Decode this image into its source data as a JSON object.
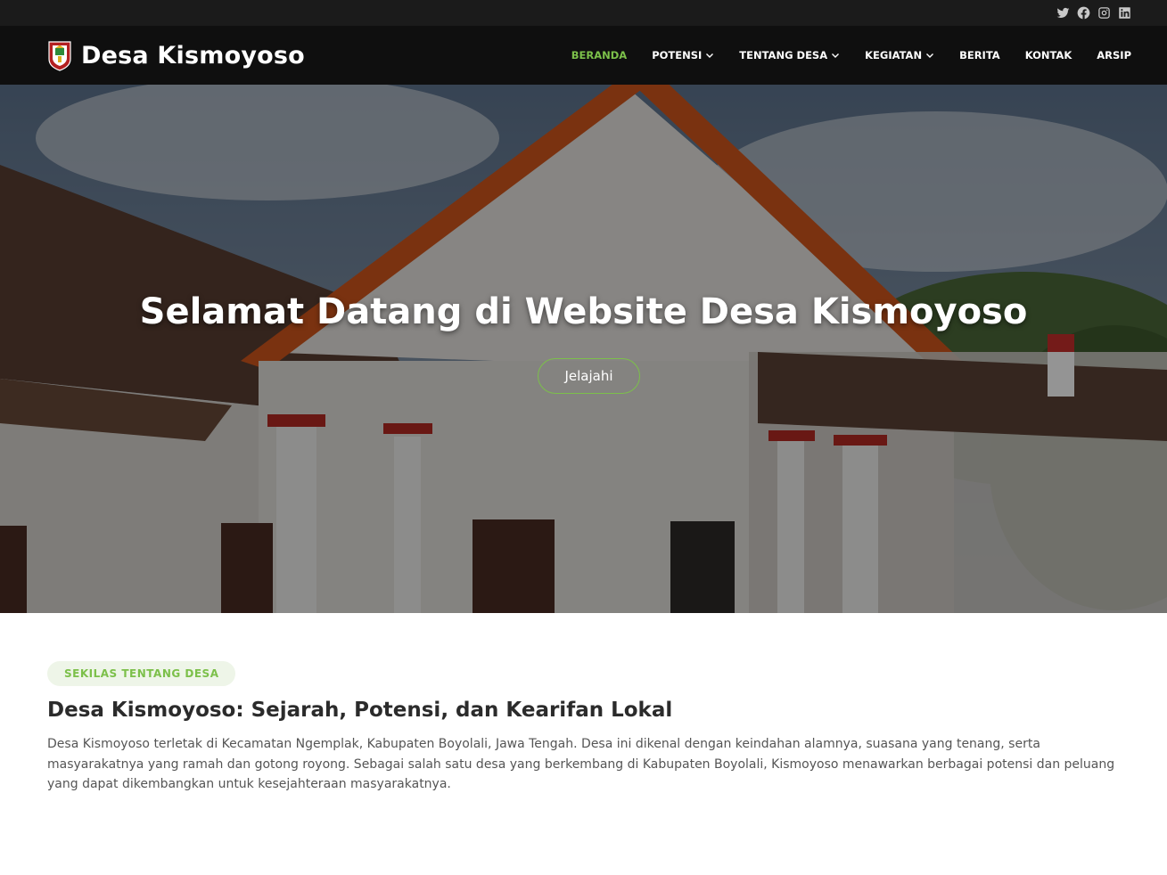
{
  "topbar": {
    "socials": [
      {
        "icon": "twitter-icon"
      },
      {
        "icon": "facebook-icon"
      },
      {
        "icon": "instagram-icon"
      },
      {
        "icon": "linkedin-icon"
      }
    ]
  },
  "header": {
    "brand_name": "Desa Kismoyoso",
    "logo_icon": "village-emblem-icon",
    "nav": {
      "beranda": "BERANDA",
      "potensi": "POTENSI",
      "tentang": "TENTANG DESA",
      "kegiatan": "KEGIATAN",
      "berita": "BERITA",
      "kontak": "KONTAK",
      "arsip": "ARSIP"
    }
  },
  "hero": {
    "title": "Selamat Datang di Website Desa Kismoyoso",
    "button_label": "Jelajahi"
  },
  "about": {
    "badge": "SEKILAS TENTANG DESA",
    "title": "Desa Kismoyoso: Sejarah, Potensi, dan Kearifan Lokal",
    "text": "Desa Kismoyoso terletak di Kecamatan Ngemplak, Kabupaten Boyolali, Jawa Tengah. Desa ini dikenal dengan keindahan alamnya, suasana yang tenang, serta masyarakatnya yang ramah dan gotong royong. Sebagai salah satu desa yang berkembang di Kabupaten Boyolali, Kismoyoso menawarkan berbagai potensi dan peluang yang dapat dikembangkan untuk kesejahteraan masyarakatnya."
  },
  "colors": {
    "accent": "#7cc04a",
    "topbar": "#1b1b1b",
    "header": "#0f0f0f",
    "badge_bg": "#eef5e8"
  }
}
